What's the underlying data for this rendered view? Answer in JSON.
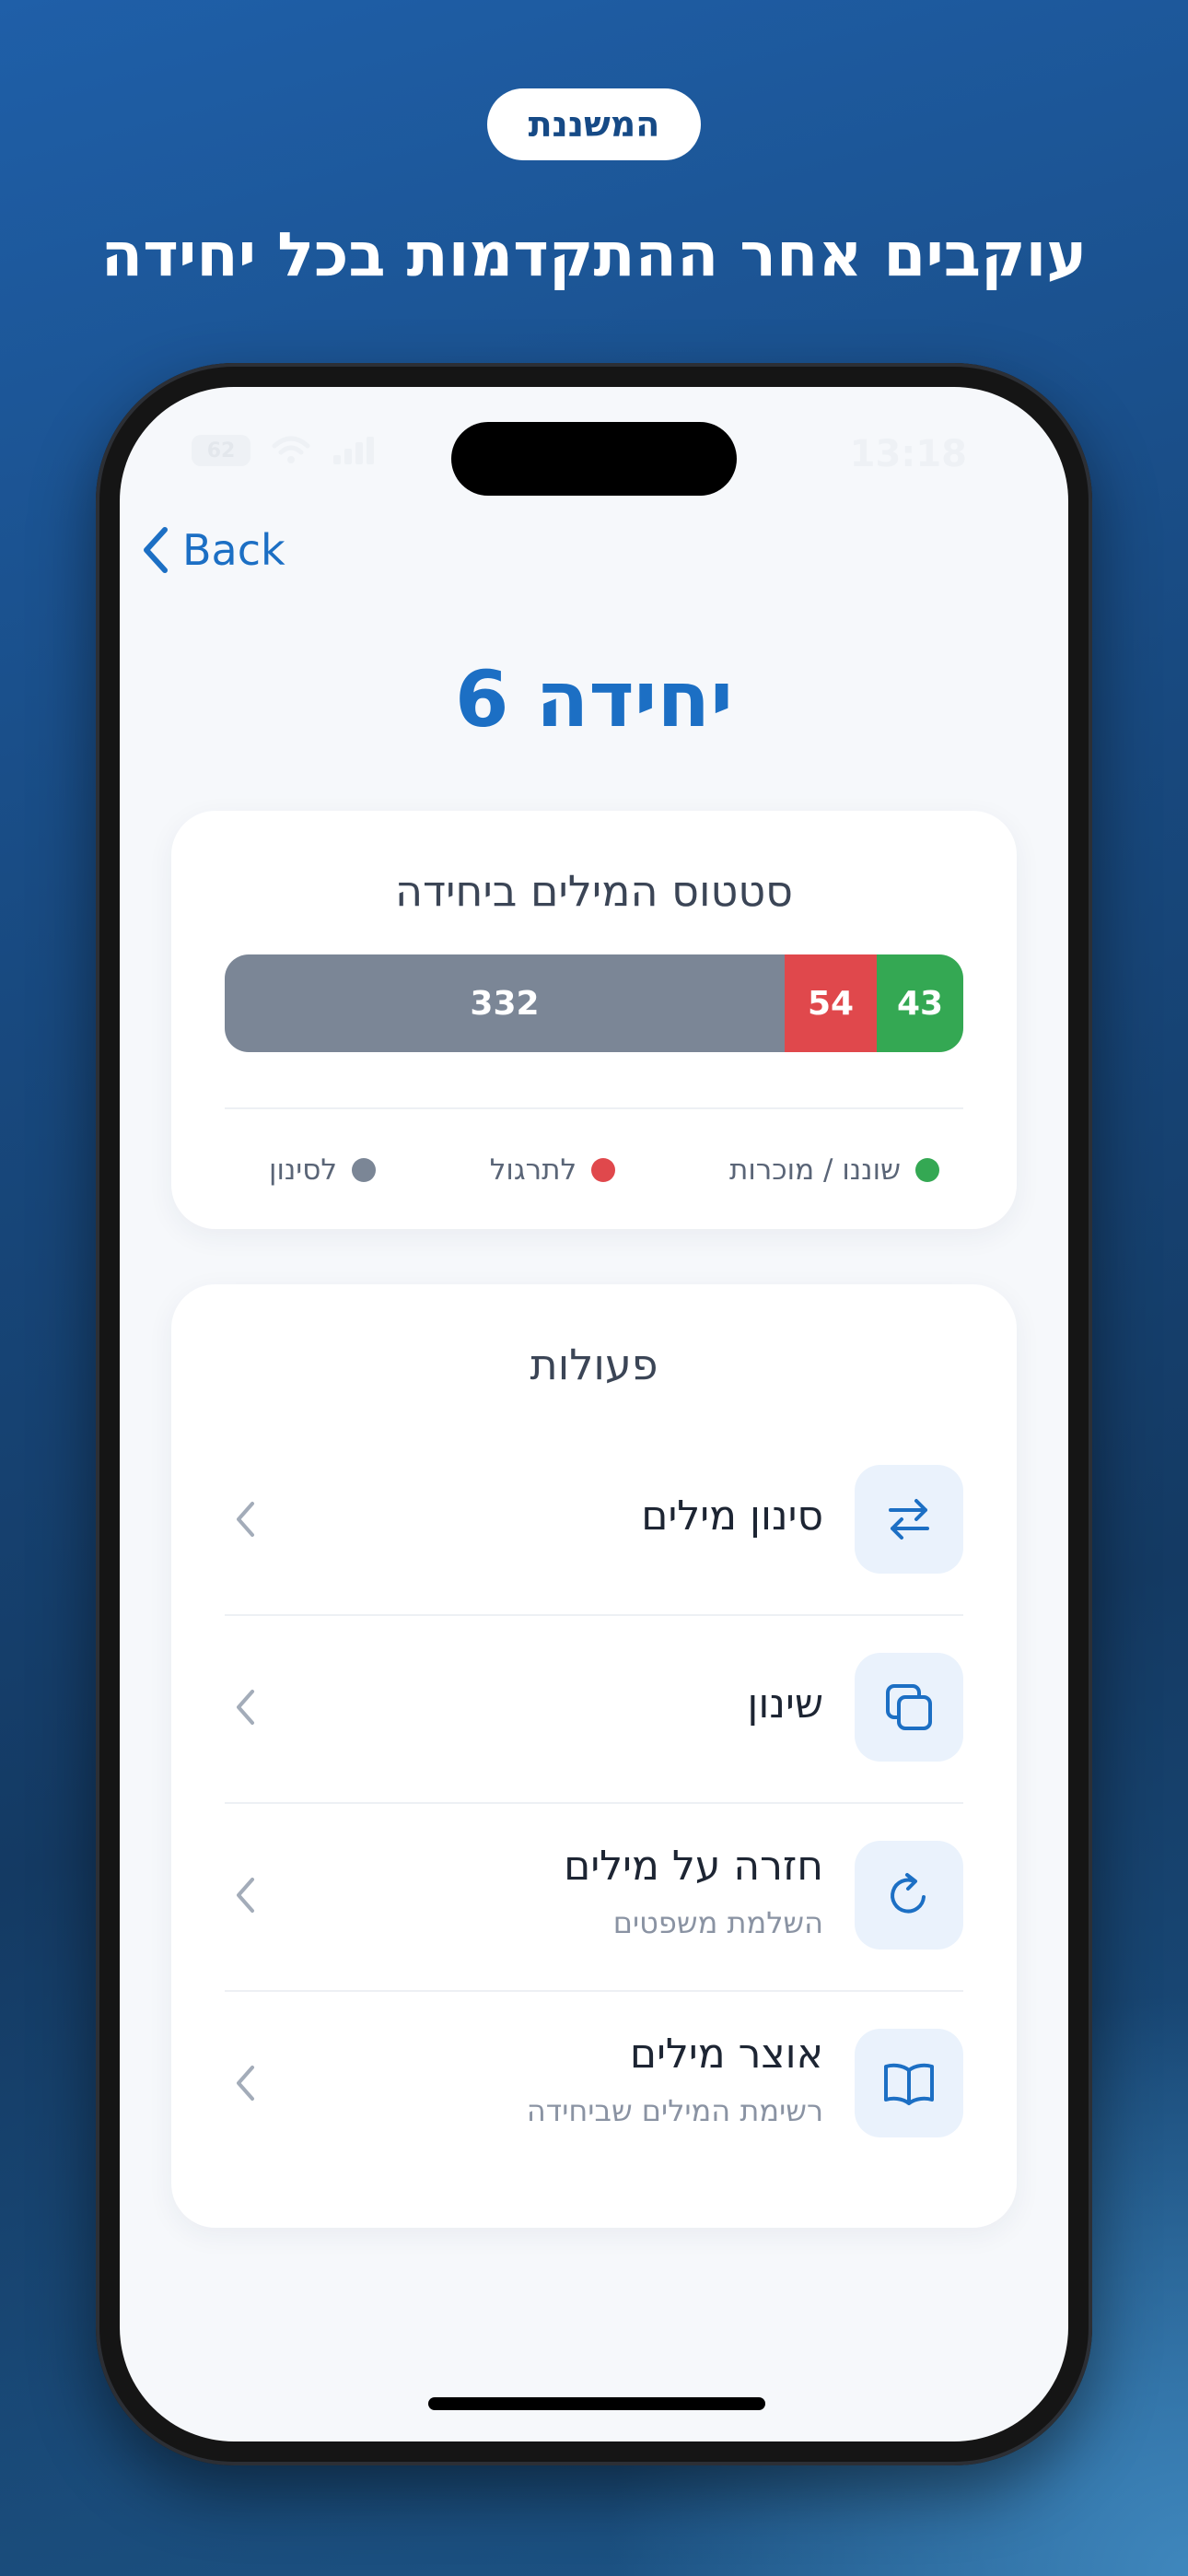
{
  "header": {
    "badge": "המשננת",
    "headline": "עוקבים אחר ההתקדמות בכל יחידה"
  },
  "status_bar": {
    "time": "13:18",
    "battery": "62"
  },
  "nav": {
    "back_label": "Back"
  },
  "page": {
    "title": "יחידה 6"
  },
  "status_card": {
    "title": "סטטוס המילים ביחידה",
    "legend": [
      {
        "label": "שוננו / מוכרות",
        "color": "#34a853"
      },
      {
        "label": "לתרגול",
        "color": "#e0484c"
      },
      {
        "label": "לסינון",
        "color": "#7b8696"
      }
    ]
  },
  "chart_data": {
    "type": "bar",
    "orientation": "horizontal-stacked",
    "categories": [
      "לסינון",
      "לתרגול",
      "שוננו / מוכרות"
    ],
    "values": [
      332,
      54,
      43
    ],
    "colors": [
      "#7b8696",
      "#e0484c",
      "#34a853"
    ],
    "title": "סטטוס המילים ביחידה",
    "legend_position": "bottom"
  },
  "actions": {
    "title": "פעולות",
    "items": [
      {
        "title": "סינון מילים",
        "subtitle": "",
        "icon": "swap-arrows-icon"
      },
      {
        "title": "שינון",
        "subtitle": "",
        "icon": "cards-stack-icon"
      },
      {
        "title": "חזרה על מילים",
        "subtitle": "השלמת משפטים",
        "icon": "refresh-icon"
      },
      {
        "title": "אוצר מילים",
        "subtitle": "רשימת המילים שביחידה",
        "icon": "open-book-icon"
      }
    ]
  },
  "colors": {
    "accent": "#1c6fc4",
    "icon_bg": "#eaf2fc"
  }
}
